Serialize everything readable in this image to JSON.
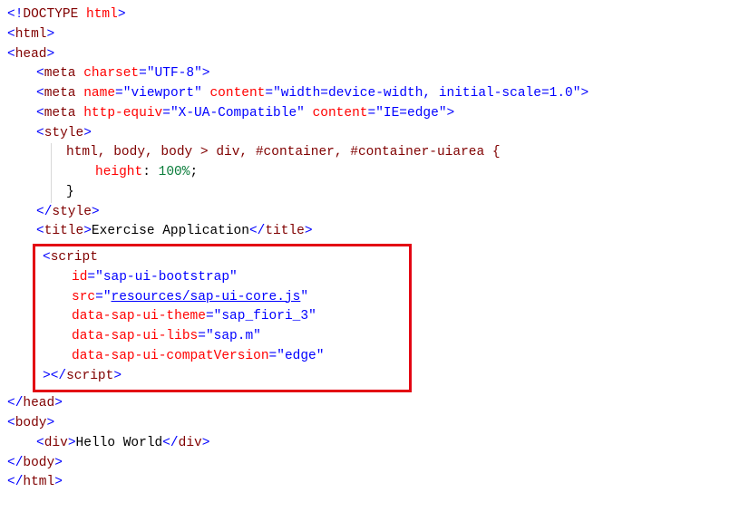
{
  "code": {
    "doctype_open": "<!",
    "doctype_name": "DOCTYPE",
    "doctype_kw": "html",
    "html_name": "html",
    "head_name": "head",
    "meta_name": "meta",
    "charset_attr": "charset",
    "charset_val": "UTF-8",
    "name_attr": "name",
    "viewport_val": "viewport",
    "content_attr": "content",
    "viewport_content": "width=device-width, initial-scale=1.0",
    "httpequiv_attr": "http-equiv",
    "xua_val": "X-UA-Compatible",
    "xua_content": "IE=edge",
    "style_name": "style",
    "css_selectors": "html, body, body > div, #container, #container-uiarea {",
    "css_prop": "height",
    "css_val": "100%",
    "css_close": "}",
    "title_name": "title",
    "title_text": "Exercise Application",
    "script_name": "script",
    "id_attr": "id",
    "id_val": "sap-ui-bootstrap",
    "src_attr": "src",
    "src_val": "resources/sap-ui-core.js",
    "theme_attr": "data-sap-ui-theme",
    "theme_val": "sap_fiori_3",
    "libs_attr": "data-sap-ui-libs",
    "libs_val": "sap.m",
    "compat_attr": "data-sap-ui-compatVersion",
    "compat_val": "edge",
    "body_name": "body",
    "div_name": "div",
    "hello": "Hello World"
  }
}
